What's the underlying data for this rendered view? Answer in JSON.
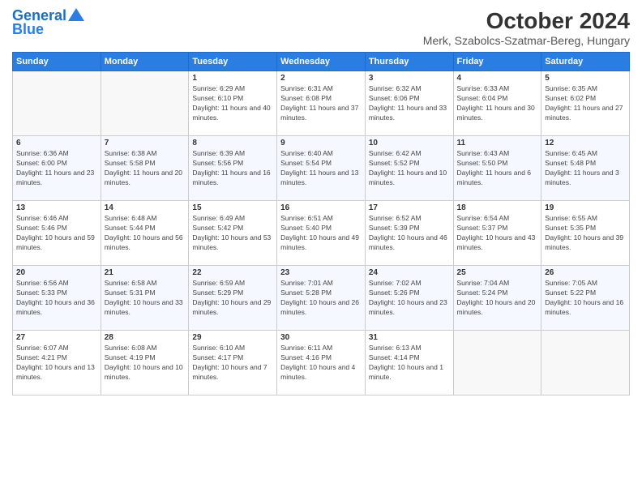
{
  "header": {
    "logo_line1": "General",
    "logo_line2": "Blue",
    "title": "October 2024",
    "subtitle": "Merk, Szabolcs-Szatmar-Bereg, Hungary"
  },
  "columns": [
    "Sunday",
    "Monday",
    "Tuesday",
    "Wednesday",
    "Thursday",
    "Friday",
    "Saturday"
  ],
  "weeks": [
    [
      {
        "day": "",
        "info": ""
      },
      {
        "day": "",
        "info": ""
      },
      {
        "day": "1",
        "info": "Sunrise: 6:29 AM\nSunset: 6:10 PM\nDaylight: 11 hours and 40 minutes."
      },
      {
        "day": "2",
        "info": "Sunrise: 6:31 AM\nSunset: 6:08 PM\nDaylight: 11 hours and 37 minutes."
      },
      {
        "day": "3",
        "info": "Sunrise: 6:32 AM\nSunset: 6:06 PM\nDaylight: 11 hours and 33 minutes."
      },
      {
        "day": "4",
        "info": "Sunrise: 6:33 AM\nSunset: 6:04 PM\nDaylight: 11 hours and 30 minutes."
      },
      {
        "day": "5",
        "info": "Sunrise: 6:35 AM\nSunset: 6:02 PM\nDaylight: 11 hours and 27 minutes."
      }
    ],
    [
      {
        "day": "6",
        "info": "Sunrise: 6:36 AM\nSunset: 6:00 PM\nDaylight: 11 hours and 23 minutes."
      },
      {
        "day": "7",
        "info": "Sunrise: 6:38 AM\nSunset: 5:58 PM\nDaylight: 11 hours and 20 minutes."
      },
      {
        "day": "8",
        "info": "Sunrise: 6:39 AM\nSunset: 5:56 PM\nDaylight: 11 hours and 16 minutes."
      },
      {
        "day": "9",
        "info": "Sunrise: 6:40 AM\nSunset: 5:54 PM\nDaylight: 11 hours and 13 minutes."
      },
      {
        "day": "10",
        "info": "Sunrise: 6:42 AM\nSunset: 5:52 PM\nDaylight: 11 hours and 10 minutes."
      },
      {
        "day": "11",
        "info": "Sunrise: 6:43 AM\nSunset: 5:50 PM\nDaylight: 11 hours and 6 minutes."
      },
      {
        "day": "12",
        "info": "Sunrise: 6:45 AM\nSunset: 5:48 PM\nDaylight: 11 hours and 3 minutes."
      }
    ],
    [
      {
        "day": "13",
        "info": "Sunrise: 6:46 AM\nSunset: 5:46 PM\nDaylight: 10 hours and 59 minutes."
      },
      {
        "day": "14",
        "info": "Sunrise: 6:48 AM\nSunset: 5:44 PM\nDaylight: 10 hours and 56 minutes."
      },
      {
        "day": "15",
        "info": "Sunrise: 6:49 AM\nSunset: 5:42 PM\nDaylight: 10 hours and 53 minutes."
      },
      {
        "day": "16",
        "info": "Sunrise: 6:51 AM\nSunset: 5:40 PM\nDaylight: 10 hours and 49 minutes."
      },
      {
        "day": "17",
        "info": "Sunrise: 6:52 AM\nSunset: 5:39 PM\nDaylight: 10 hours and 46 minutes."
      },
      {
        "day": "18",
        "info": "Sunrise: 6:54 AM\nSunset: 5:37 PM\nDaylight: 10 hours and 43 minutes."
      },
      {
        "day": "19",
        "info": "Sunrise: 6:55 AM\nSunset: 5:35 PM\nDaylight: 10 hours and 39 minutes."
      }
    ],
    [
      {
        "day": "20",
        "info": "Sunrise: 6:56 AM\nSunset: 5:33 PM\nDaylight: 10 hours and 36 minutes."
      },
      {
        "day": "21",
        "info": "Sunrise: 6:58 AM\nSunset: 5:31 PM\nDaylight: 10 hours and 33 minutes."
      },
      {
        "day": "22",
        "info": "Sunrise: 6:59 AM\nSunset: 5:29 PM\nDaylight: 10 hours and 29 minutes."
      },
      {
        "day": "23",
        "info": "Sunrise: 7:01 AM\nSunset: 5:28 PM\nDaylight: 10 hours and 26 minutes."
      },
      {
        "day": "24",
        "info": "Sunrise: 7:02 AM\nSunset: 5:26 PM\nDaylight: 10 hours and 23 minutes."
      },
      {
        "day": "25",
        "info": "Sunrise: 7:04 AM\nSunset: 5:24 PM\nDaylight: 10 hours and 20 minutes."
      },
      {
        "day": "26",
        "info": "Sunrise: 7:05 AM\nSunset: 5:22 PM\nDaylight: 10 hours and 16 minutes."
      }
    ],
    [
      {
        "day": "27",
        "info": "Sunrise: 6:07 AM\nSunset: 4:21 PM\nDaylight: 10 hours and 13 minutes."
      },
      {
        "day": "28",
        "info": "Sunrise: 6:08 AM\nSunset: 4:19 PM\nDaylight: 10 hours and 10 minutes."
      },
      {
        "day": "29",
        "info": "Sunrise: 6:10 AM\nSunset: 4:17 PM\nDaylight: 10 hours and 7 minutes."
      },
      {
        "day": "30",
        "info": "Sunrise: 6:11 AM\nSunset: 4:16 PM\nDaylight: 10 hours and 4 minutes."
      },
      {
        "day": "31",
        "info": "Sunrise: 6:13 AM\nSunset: 4:14 PM\nDaylight: 10 hours and 1 minute."
      },
      {
        "day": "",
        "info": ""
      },
      {
        "day": "",
        "info": ""
      }
    ]
  ]
}
